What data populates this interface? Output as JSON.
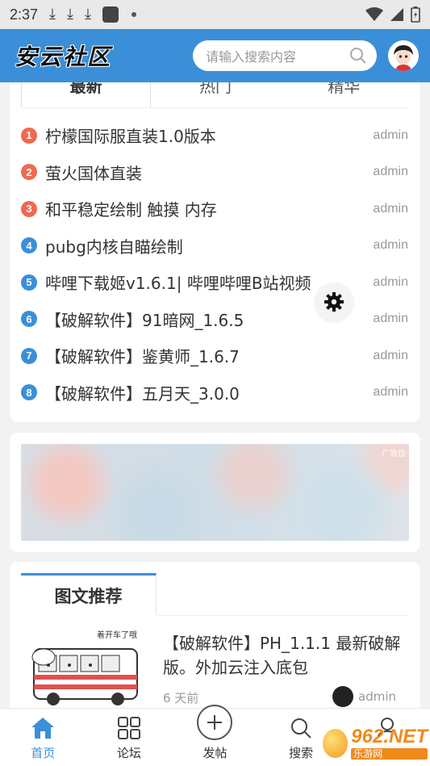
{
  "status_bar": {
    "time": "2:37"
  },
  "header": {
    "logo": "安云社区",
    "search_placeholder": "请输入搜索内容"
  },
  "tabs": [
    {
      "label": "最新",
      "active": true
    },
    {
      "label": "热门",
      "active": false
    },
    {
      "label": "精华",
      "active": false
    }
  ],
  "list": [
    {
      "rank": "1",
      "title": "柠檬国际服直装1.0版本",
      "author": "admin"
    },
    {
      "rank": "2",
      "title": "萤火国体直装",
      "author": "admin"
    },
    {
      "rank": "3",
      "title": "和平稳定绘制 触摸 内存",
      "author": "admin"
    },
    {
      "rank": "4",
      "title": "pubg内核自瞄绘制",
      "author": "admin"
    },
    {
      "rank": "5",
      "title": "哔哩下载姬v1.6.1| 哔哩哔哩B站视频",
      "author": "admin"
    },
    {
      "rank": "6",
      "title": "【破解软件】91暗网_1.6.5",
      "author": "admin"
    },
    {
      "rank": "7",
      "title": "【破解软件】鉴黄师_1.6.7",
      "author": "admin"
    },
    {
      "rank": "8",
      "title": "【破解软件】五月天_3.0.0",
      "author": "admin"
    }
  ],
  "ad": {
    "label": "广告位"
  },
  "recommend": {
    "tab_label": "图文推荐",
    "thumb_text": "着开车了哦",
    "title": "【破解软件】PH_1.1.1 最新破解版。外加云注入底包",
    "time": "6 天前",
    "author": "admin"
  },
  "bottom_nav": [
    {
      "label": "首页",
      "icon": "home-icon",
      "active": true
    },
    {
      "label": "论坛",
      "icon": "grid-icon",
      "active": false
    },
    {
      "label": "发帖",
      "icon": "plus-circle-icon",
      "active": false
    },
    {
      "label": "搜索",
      "icon": "search-icon",
      "active": false
    },
    {
      "label": "",
      "icon": "user-icon",
      "active": false
    }
  ],
  "watermark": {
    "big": "962.NET",
    "small": "乐游网"
  },
  "colors": {
    "accent": "#3b8fd8",
    "hot_rank": "#ee6a50",
    "cold_rank": "#3b8fd8"
  }
}
